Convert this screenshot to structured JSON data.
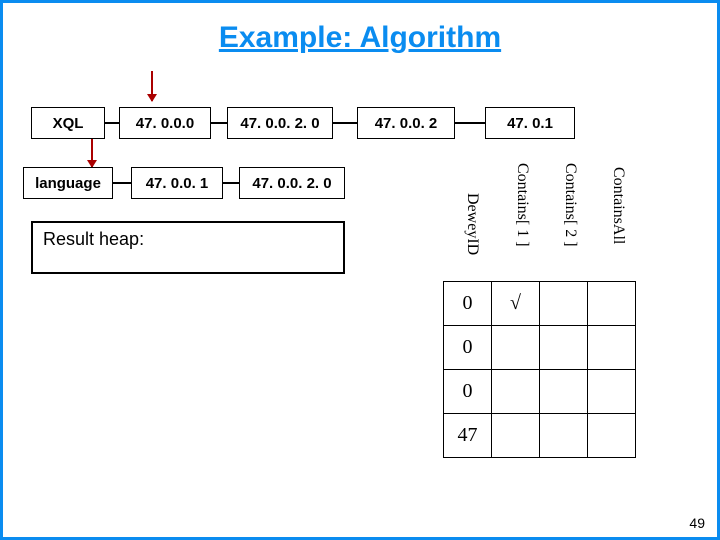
{
  "title": "Example: Algorithm",
  "row1": {
    "c0": "XQL",
    "c1": "47. 0.0.0",
    "c2": "47. 0.0. 2. 0",
    "c3": "47. 0.0. 2",
    "c4": "47. 0.1"
  },
  "row2": {
    "c0": "language",
    "c1": "47. 0.0. 1",
    "c2": "47. 0.0. 2. 0"
  },
  "result_heap_label": "Result heap:",
  "headers": {
    "h0": "DeweyID",
    "h1": "Contains[ 1 ]",
    "h2": "Contains[ 2 ]",
    "h3": "ContainsAll"
  },
  "table": {
    "r0c0": "0",
    "r0c1": "√",
    "r0c2": "",
    "r0c3": "",
    "r1c0": "0",
    "r1c1": "",
    "r1c2": "",
    "r1c3": "",
    "r2c0": "0",
    "r2c1": "",
    "r2c2": "",
    "r2c3": "",
    "r3c0": "47",
    "r3c1": "",
    "r3c2": "",
    "r3c3": ""
  },
  "page_number": "49"
}
